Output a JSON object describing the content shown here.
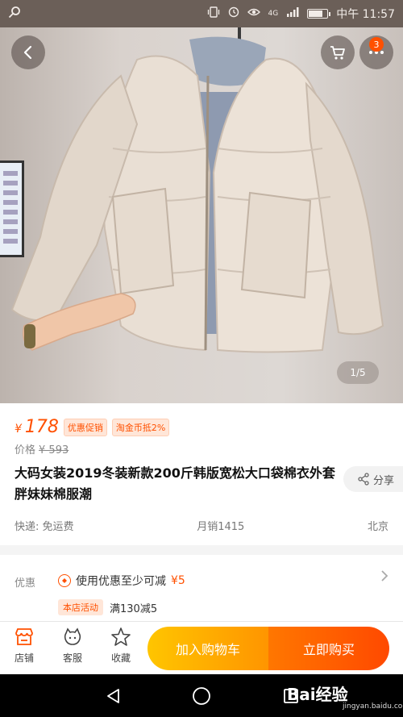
{
  "status_bar": {
    "network_label": "4G",
    "time": "中午 11:57"
  },
  "photo": {
    "pager": "1/5",
    "cart_badge": "3"
  },
  "product": {
    "currency": "¥",
    "price": "178",
    "tags": [
      "优惠促销",
      "淘金币抵2%"
    ],
    "old_price_label": "价格",
    "old_price": "¥ 593",
    "title": "大码女装2019冬装新款200斤韩版宽松大口袋棉衣外套胖妹妹棉服潮",
    "share_label": "分享",
    "shipping": "快递: 免运费",
    "monthly_sales": "月销1415",
    "location": "北京"
  },
  "promo": {
    "label": "优惠",
    "coupon_text": "使用优惠至少可减",
    "coupon_amount": "¥5",
    "store_tag": "本店活动",
    "store_offer": "满130减5"
  },
  "action_bar": {
    "shop": "店铺",
    "service": "客服",
    "favorite": "收藏",
    "add_to_cart": "加入购物车",
    "buy_now": "立即购买"
  },
  "watermark": {
    "brand": "Bai经验",
    "url": "jingyan.baidu.com"
  },
  "colors": {
    "accent": "#ff5000",
    "cart_button": "#ffb000",
    "buy_button": "#ff5a00"
  }
}
